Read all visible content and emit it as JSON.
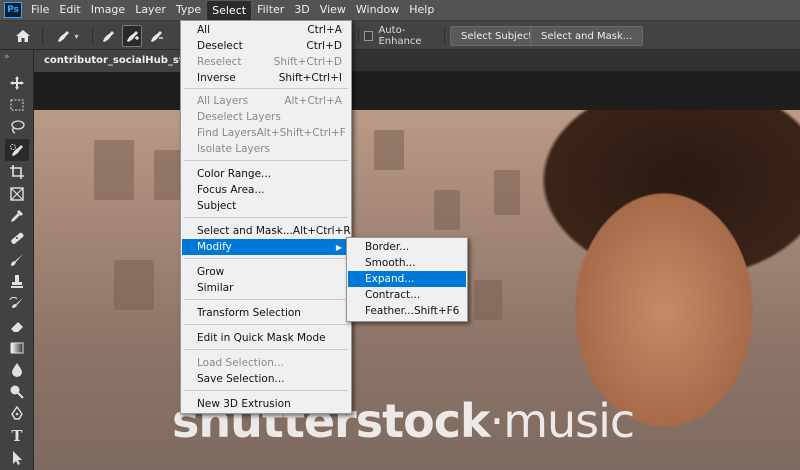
{
  "app": {
    "logo_text": "Ps"
  },
  "menubar": {
    "items": [
      "File",
      "Edit",
      "Image",
      "Layer",
      "Type",
      "Select",
      "Filter",
      "3D",
      "View",
      "Window",
      "Help"
    ],
    "active": "Select"
  },
  "options": {
    "auto_enhance_label": "Auto-Enhance",
    "select_subject_label": "Select Subject",
    "select_and_mask_label": "Select and Mask..."
  },
  "document": {
    "tab_title": "contributor_socialHub_sttkmusic"
  },
  "watermark": {
    "text_bold": "shutterst",
    "text_o": "o",
    "text_ck": "ck",
    "text_dot": "·",
    "text_music": "music"
  },
  "select_menu": {
    "items": [
      {
        "label": "All",
        "shortcut": "Ctrl+A",
        "disabled": false
      },
      {
        "label": "Deselect",
        "shortcut": "Ctrl+D",
        "disabled": false
      },
      {
        "label": "Reselect",
        "shortcut": "Shift+Ctrl+D",
        "disabled": true
      },
      {
        "label": "Inverse",
        "shortcut": "Shift+Ctrl+I",
        "disabled": false
      },
      {
        "label": "All Layers",
        "shortcut": "Alt+Ctrl+A",
        "disabled": true
      },
      {
        "label": "Deselect Layers",
        "shortcut": "",
        "disabled": true
      },
      {
        "label": "Find Layers",
        "shortcut": "Alt+Shift+Ctrl+F",
        "disabled": true
      },
      {
        "label": "Isolate Layers",
        "shortcut": "",
        "disabled": true
      },
      {
        "label": "Color Range...",
        "shortcut": "",
        "disabled": false
      },
      {
        "label": "Focus Area...",
        "shortcut": "",
        "disabled": false
      },
      {
        "label": "Subject",
        "shortcut": "",
        "disabled": false
      },
      {
        "label": "Select and Mask...",
        "shortcut": "Alt+Ctrl+R",
        "disabled": false
      },
      {
        "label": "Modify",
        "shortcut": "",
        "disabled": false
      },
      {
        "label": "Grow",
        "shortcut": "",
        "disabled": false
      },
      {
        "label": "Similar",
        "shortcut": "",
        "disabled": false
      },
      {
        "label": "Transform Selection",
        "shortcut": "",
        "disabled": false
      },
      {
        "label": "Edit in Quick Mask Mode",
        "shortcut": "",
        "disabled": false
      },
      {
        "label": "Load Selection...",
        "shortcut": "",
        "disabled": true
      },
      {
        "label": "Save Selection...",
        "shortcut": "",
        "disabled": false
      },
      {
        "label": "New 3D Extrusion",
        "shortcut": "",
        "disabled": false
      }
    ]
  },
  "modify_menu": {
    "items": [
      {
        "label": "Border...",
        "shortcut": ""
      },
      {
        "label": "Smooth...",
        "shortcut": ""
      },
      {
        "label": "Expand...",
        "shortcut": ""
      },
      {
        "label": "Contract...",
        "shortcut": ""
      },
      {
        "label": "Feather...",
        "shortcut": "Shift+F6"
      }
    ]
  },
  "colors": {
    "highlight": "#0078d7",
    "menu_bg": "#f0f0f0",
    "chrome": "#535353"
  }
}
